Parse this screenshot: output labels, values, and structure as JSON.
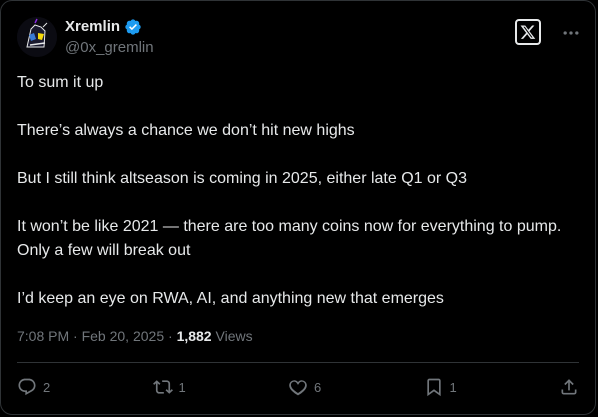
{
  "author": {
    "display_name": "Xremlin",
    "handle": "@0x_gremlin",
    "verified": true
  },
  "tweet": {
    "paragraphs": [
      "To sum it up",
      "There’s always a chance we don’t hit new highs",
      "But I still think altseason is coming in 2025, either late Q1 or Q3",
      "It won’t be like 2021 — there are too many coins now for everything to pump. Only a few will break out",
      "I’d keep an eye on RWA, AI, and anything new that emerges"
    ],
    "time": "7:08 PM",
    "separator": " · ",
    "date": "Feb 20, 2025",
    "views_count": "1,882",
    "views_label": "Views"
  },
  "actions": {
    "replies": "2",
    "reposts": "1",
    "likes": "6",
    "bookmarks": "1"
  },
  "icons": {
    "verified": "verified-badge-icon",
    "brand": "x-logo-icon",
    "more": "more-dots-icon",
    "reply": "reply-icon",
    "repost": "repost-icon",
    "like": "heart-icon",
    "bookmark": "bookmark-icon",
    "share": "share-icon"
  },
  "colors": {
    "background": "#000000",
    "text": "#e7e9ea",
    "muted": "#71767b",
    "verified": "#1d9bf0",
    "border": "#2f3336"
  }
}
